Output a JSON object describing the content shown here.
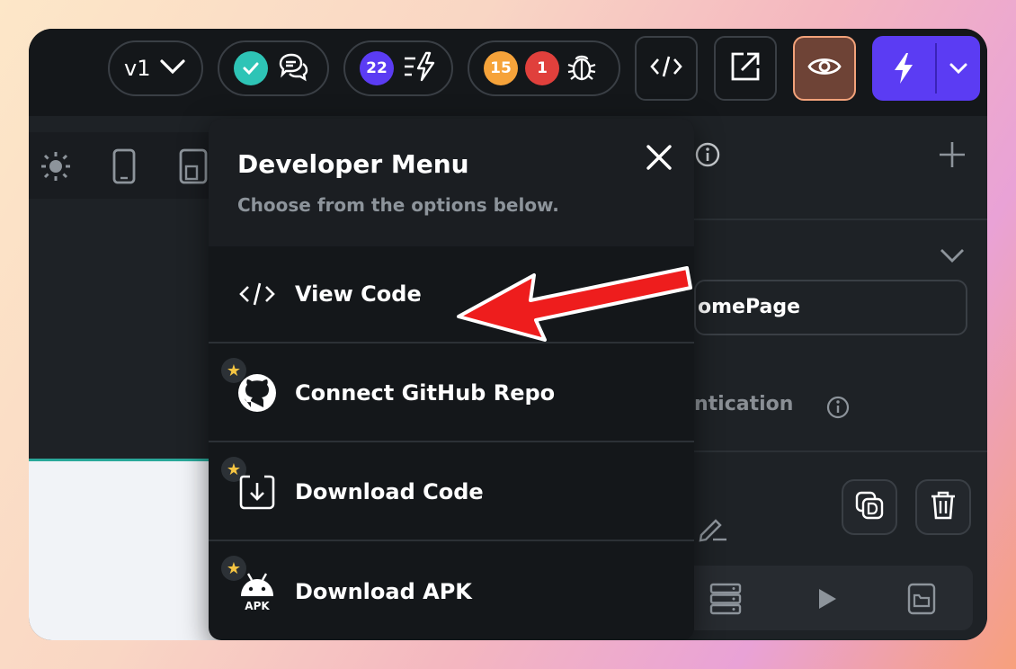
{
  "topbar": {
    "version_label": "v1",
    "badges": {
      "tasks_count": "22",
      "warnings_count": "15",
      "errors_count": "1"
    }
  },
  "colors": {
    "accent_purple": "#5b3cf3",
    "check_teal": "#2ec4b6",
    "warning_orange": "#f6a33a",
    "error_red": "#e0403c",
    "preview_brown": "#6e4336"
  },
  "right_panel": {
    "page_name_partial": "omePage",
    "auth_label_partial": "ntication"
  },
  "developer_menu": {
    "title": "Developer Menu",
    "subtitle": "Choose from the options below.",
    "items": [
      {
        "label": "View Code",
        "icon": "code-icon",
        "premium": false
      },
      {
        "label": "Connect GitHub Repo",
        "icon": "github-icon",
        "premium": true
      },
      {
        "label": "Download Code",
        "icon": "download-icon",
        "premium": true
      },
      {
        "label": "Download APK",
        "icon": "android-icon",
        "premium": true,
        "icon_caption": "APK"
      }
    ]
  }
}
